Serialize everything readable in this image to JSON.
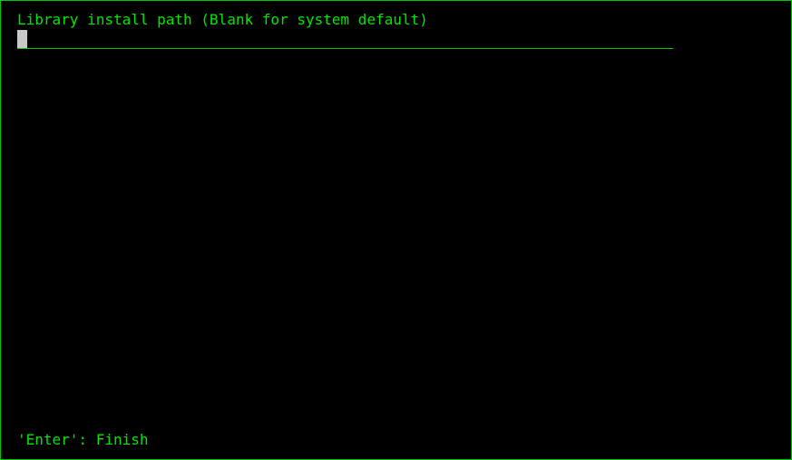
{
  "prompt": {
    "label": "Library install path (Blank for system default)"
  },
  "input": {
    "value": ""
  },
  "footer": {
    "hint": "'Enter': Finish"
  },
  "colors": {
    "background": "#000000",
    "text": "#00e600",
    "border": "#00c800",
    "cursor": "#c8c8c8"
  }
}
